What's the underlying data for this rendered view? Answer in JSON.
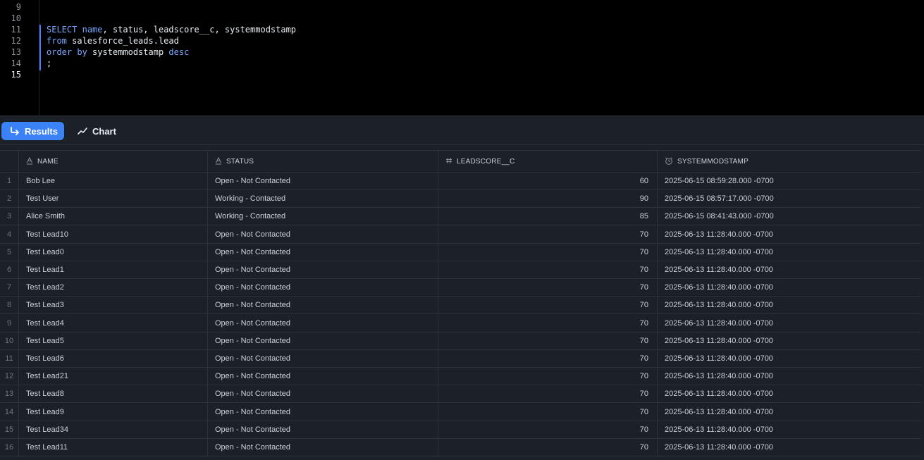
{
  "editor": {
    "lines": [
      {
        "num": "9",
        "tokens": []
      },
      {
        "num": "10",
        "tokens": []
      },
      {
        "num": "11",
        "tokens": [
          {
            "t": "SELECT",
            "k": true
          },
          {
            "t": " ",
            "k": false
          },
          {
            "t": "name",
            "k": true
          },
          {
            "t": ", status, leadscore__c, systemmodstamp",
            "k": false
          }
        ]
      },
      {
        "num": "12",
        "tokens": [
          {
            "t": "from",
            "k": true
          },
          {
            "t": " salesforce_leads.lead",
            "k": false
          }
        ]
      },
      {
        "num": "13",
        "tokens": [
          {
            "t": "order by",
            "k": true
          },
          {
            "t": " systemmodstamp ",
            "k": false
          },
          {
            "t": "desc",
            "k": true
          }
        ]
      },
      {
        "num": "14",
        "tokens": [
          {
            "t": ";",
            "k": false
          }
        ]
      },
      {
        "num": "15",
        "tokens": [],
        "active": true
      }
    ]
  },
  "toolbar": {
    "results_label": "Results",
    "chart_label": "Chart"
  },
  "table": {
    "columns": [
      {
        "label": "NAME",
        "type_icon": "text-type-icon"
      },
      {
        "label": "STATUS",
        "type_icon": "text-type-icon"
      },
      {
        "label": "LEADSCORE__C",
        "type_icon": "number-type-icon"
      },
      {
        "label": "SYSTEMMODSTAMP",
        "type_icon": "timestamp-type-icon"
      }
    ],
    "rows": [
      [
        "1",
        "Bob Lee",
        "Open - Not Contacted",
        "60",
        "2025-06-15 08:59:28.000 -0700"
      ],
      [
        "2",
        "Test User",
        "Working - Contacted",
        "90",
        "2025-06-15 08:57:17.000 -0700"
      ],
      [
        "3",
        "Alice Smith",
        "Working - Contacted",
        "85",
        "2025-06-15 08:41:43.000 -0700"
      ],
      [
        "4",
        "Test Lead10",
        "Open - Not Contacted",
        "70",
        "2025-06-13 11:28:40.000 -0700"
      ],
      [
        "5",
        "Test Lead0",
        "Open - Not Contacted",
        "70",
        "2025-06-13 11:28:40.000 -0700"
      ],
      [
        "6",
        "Test Lead1",
        "Open - Not Contacted",
        "70",
        "2025-06-13 11:28:40.000 -0700"
      ],
      [
        "7",
        "Test Lead2",
        "Open - Not Contacted",
        "70",
        "2025-06-13 11:28:40.000 -0700"
      ],
      [
        "8",
        "Test Lead3",
        "Open - Not Contacted",
        "70",
        "2025-06-13 11:28:40.000 -0700"
      ],
      [
        "9",
        "Test Lead4",
        "Open - Not Contacted",
        "70",
        "2025-06-13 11:28:40.000 -0700"
      ],
      [
        "10",
        "Test Lead5",
        "Open - Not Contacted",
        "70",
        "2025-06-13 11:28:40.000 -0700"
      ],
      [
        "11",
        "Test Lead6",
        "Open - Not Contacted",
        "70",
        "2025-06-13 11:28:40.000 -0700"
      ],
      [
        "12",
        "Test Lead21",
        "Open - Not Contacted",
        "70",
        "2025-06-13 11:28:40.000 -0700"
      ],
      [
        "13",
        "Test Lead8",
        "Open - Not Contacted",
        "70",
        "2025-06-13 11:28:40.000 -0700"
      ],
      [
        "14",
        "Test Lead9",
        "Open - Not Contacted",
        "70",
        "2025-06-13 11:28:40.000 -0700"
      ],
      [
        "15",
        "Test Lead34",
        "Open - Not Contacted",
        "70",
        "2025-06-13 11:28:40.000 -0700"
      ],
      [
        "16",
        "Test Lead11",
        "Open - Not Contacted",
        "70",
        "2025-06-13 11:28:40.000 -0700"
      ]
    ]
  },
  "colors": {
    "accent": "#3b82f6",
    "keyword": "#79a8ff",
    "selection_bar": "#4f7cff",
    "background": "#1c2128",
    "editor_background": "#000000"
  }
}
